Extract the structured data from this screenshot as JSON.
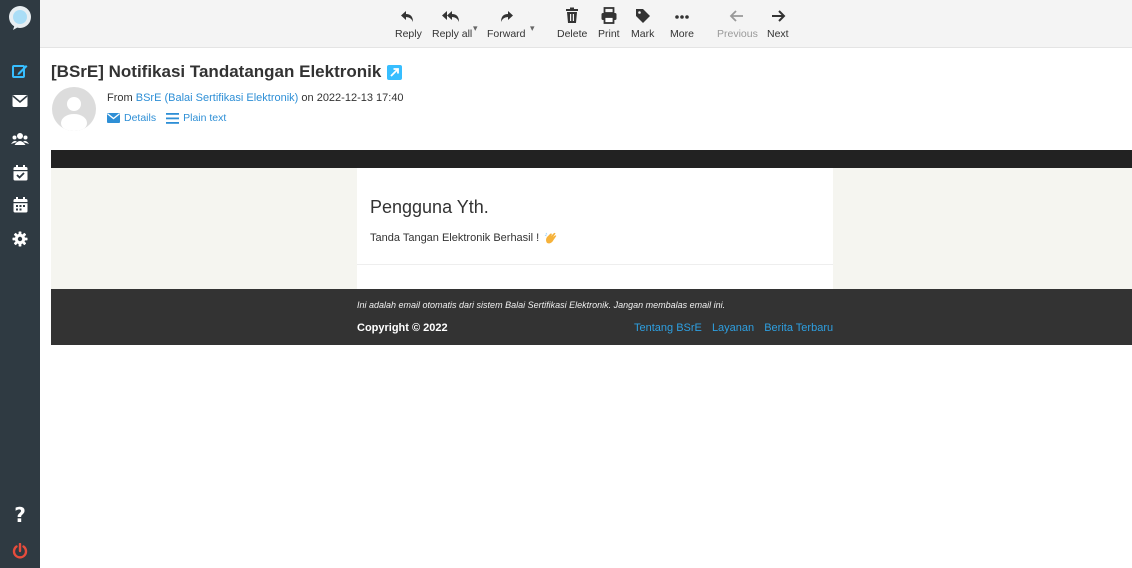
{
  "toolbar": {
    "reply": "Reply",
    "reply_all": "Reply all",
    "forward": "Forward",
    "delete": "Delete",
    "print": "Print",
    "mark": "Mark",
    "more": "More",
    "previous": "Previous",
    "next": "Next"
  },
  "message": {
    "subject": "[BSrE] Notifikasi Tandatangan Elektronik",
    "from_prefix": "From",
    "sender": "BSrE (Balai Sertifikasi Elektronik)",
    "date_text": "on 2022-12-13 17:40",
    "details_label": "Details",
    "plaintext_label": "Plain text"
  },
  "email": {
    "greeting": "Pengguna Yth.",
    "body": "Tanda Tangan Elektronik Berhasil !",
    "footer_notice": "Ini adalah email otomatis dari sistem Balai Sertifikasi Elektronik. Jangan membalas email ini.",
    "copyright": "Copyright © 2022",
    "footer_links": [
      "Tentang BSrE",
      "Layanan",
      "Berita Terbaru"
    ]
  },
  "sidebar": {
    "icons": [
      "compose-icon",
      "mail-icon",
      "contacts-icon",
      "tasks-icon",
      "calendar-icon",
      "settings-icon",
      "help-icon",
      "logout-icon"
    ]
  },
  "colors": {
    "sidebar_bg": "#2f3a42",
    "accent": "#37beff",
    "link": "#2e8fd6",
    "logout": "#e74c3c"
  }
}
